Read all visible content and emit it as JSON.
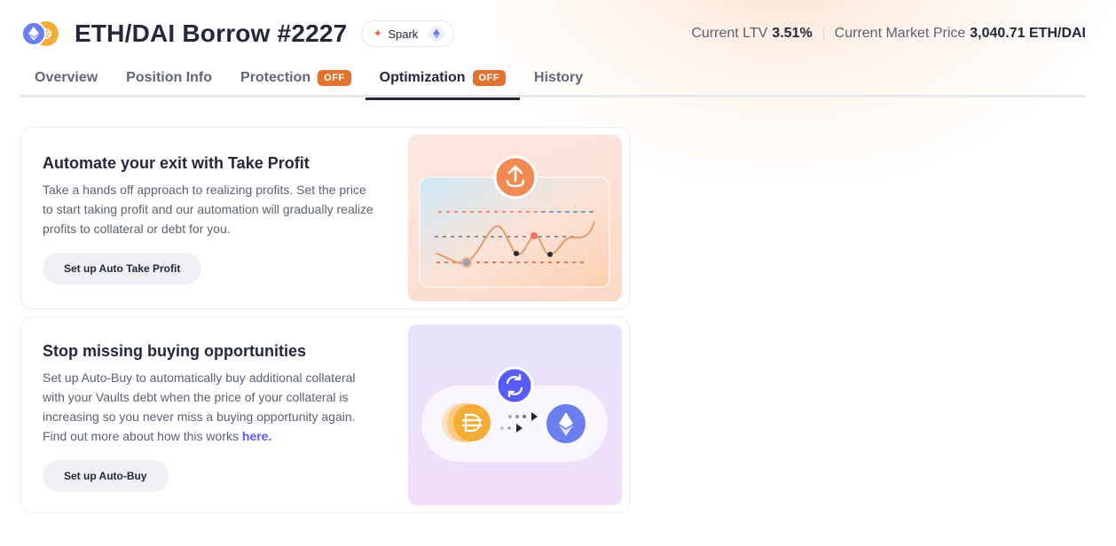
{
  "header": {
    "title": "ETH/DAI Borrow #2227",
    "protocol": "Spark",
    "collateral_token_icon": "eth-icon",
    "debt_token_icon": "dai-icon",
    "ltv_label": "Current LTV",
    "ltv_value": "3.51%",
    "price_label": "Current Market Price",
    "price_value": "3,040.71 ETH/DAI"
  },
  "tabs": [
    {
      "label": "Overview"
    },
    {
      "label": "Position Info"
    },
    {
      "label": "Protection",
      "badge": "OFF"
    },
    {
      "label": "Optimization",
      "badge": "OFF",
      "active": true
    },
    {
      "label": "History"
    }
  ],
  "cards": {
    "take_profit": {
      "title": "Automate your exit with Take Profit",
      "description": "Take a hands off approach to realizing profits. Set the price to start taking profit and our automation will gradually realize profits to collateral or debt for you.",
      "button": "Set up Auto Take Profit",
      "icon": "upload-arrow-icon"
    },
    "auto_buy": {
      "title": "Stop missing buying opportunities",
      "description": "Set up Auto-Buy to automatically buy additional collateral with your Vaults debt when the price of your collateral is increasing so you never miss a buying opportunity again. Find out more about how this works",
      "link": "here.",
      "button": "Set up Auto-Buy",
      "icon": "refresh-icon"
    }
  },
  "colors": {
    "accent_orange": "#e3722e",
    "link_purple": "#575cfe",
    "eth_blue": "#6a7ef0",
    "dai_yellow": "#f5ac37"
  }
}
